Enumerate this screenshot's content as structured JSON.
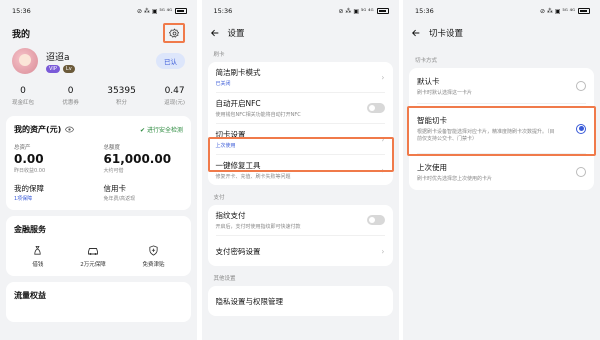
{
  "status": {
    "time": "15:36",
    "icons": "⊘ ⁂ ▣ ⁵ᴳ ⁴ᴳ"
  },
  "screen1": {
    "title": "我的",
    "username": "迢迢a",
    "badge_vip": "VIP",
    "badge_level": "Lv",
    "verified_label": "已认",
    "stats": [
      {
        "num": "0",
        "label": "现金红包"
      },
      {
        "num": "0",
        "label": "优惠券"
      },
      {
        "num": "35395",
        "label": "积分"
      },
      {
        "num": "0.47",
        "label": "返现(元)"
      }
    ],
    "assets": {
      "title": "我的资产(元)",
      "safe": "进行安全检测",
      "total_label": "总资产",
      "total_value": "0.00",
      "total_sub": "昨日收益0.00",
      "credit_label": "总额度",
      "credit_value": "61,000.00",
      "credit_sub": "大约可借",
      "guarantee_title": "我的保障",
      "guarantee_sub": "1项保障",
      "card_title": "信用卡",
      "card_sub": "免年费/高返现"
    },
    "finance": {
      "title": "金融服务",
      "items": [
        {
          "icon": "money-bag-icon",
          "label": "借钱"
        },
        {
          "icon": "car-icon",
          "label": "2万元保障"
        },
        {
          "icon": "shield-plus-icon",
          "label": "免费津贴"
        }
      ]
    },
    "flow_title": "流量权益"
  },
  "screen2": {
    "title": "设置",
    "section1": "刷卡",
    "items": [
      {
        "title": "简洁刷卡模式",
        "sub": "已关闭",
        "control": "chevron"
      },
      {
        "title": "自动开启NFC",
        "sub": "使用钱包NFC相关功能将自动打开NFC",
        "control": "toggle"
      },
      {
        "title": "切卡设置",
        "sub": "上次使用",
        "control": "chevron"
      },
      {
        "title": "一键修复工具",
        "sub": "修复开卡、充值、刷卡失败等问题",
        "control": "chevron"
      }
    ],
    "section2": "支付",
    "pay_items": [
      {
        "title": "指纹支付",
        "sub": "开启后，支付时使用指纹即可快速付款",
        "control": "toggle"
      },
      {
        "title": "支付密码设置",
        "sub": "",
        "control": "chevron"
      }
    ],
    "section3": "其他设置",
    "tail_item": "隐私设置与权限管理"
  },
  "screen3": {
    "title": "切卡设置",
    "section": "切卡方式",
    "options": [
      {
        "title": "默认卡",
        "sub": "刷卡时默认选择这一卡片",
        "selected": false
      },
      {
        "title": "智能切卡",
        "sub": "根据刷卡设备智能选择对应卡片，精准度随刷卡次数提升。（目前仅支持公交卡、门禁卡）",
        "selected": true
      },
      {
        "title": "上次使用",
        "sub": "刷卡时优先选择您上次使用的卡片",
        "selected": false
      }
    ]
  }
}
